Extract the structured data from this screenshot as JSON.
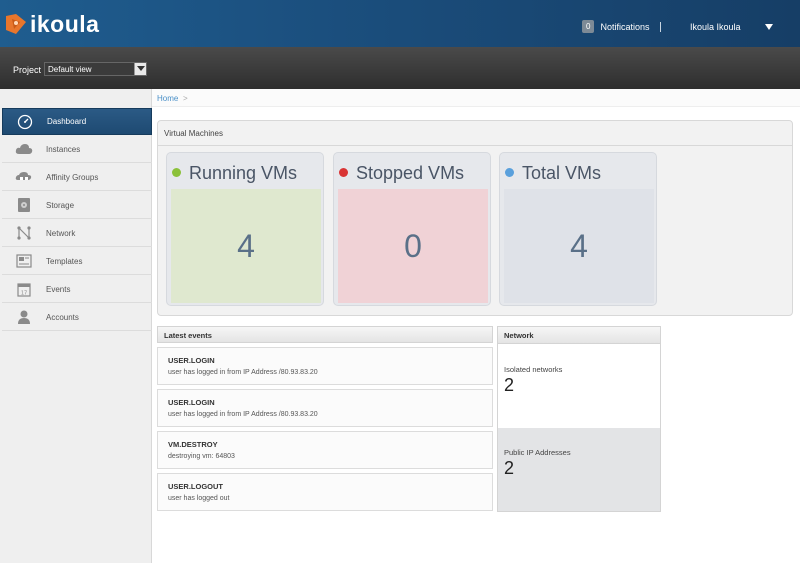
{
  "header": {
    "logo_text": "ikoula",
    "notifications_count": "0",
    "notifications_label": "Notifications",
    "separator": "|",
    "user_name": "Ikoula Ikoula"
  },
  "project": {
    "label": "Project",
    "selected": "Default view"
  },
  "sidebar": {
    "items": [
      {
        "label": "Dashboard",
        "icon": "dashboard-icon",
        "active": true
      },
      {
        "label": "Instances",
        "icon": "cloud-icon"
      },
      {
        "label": "Affinity Groups",
        "icon": "affinity-icon"
      },
      {
        "label": "Storage",
        "icon": "storage-icon"
      },
      {
        "label": "Network",
        "icon": "network-icon"
      },
      {
        "label": "Templates",
        "icon": "templates-icon"
      },
      {
        "label": "Events",
        "icon": "calendar-icon"
      },
      {
        "label": "Accounts",
        "icon": "user-icon"
      }
    ]
  },
  "breadcrumb": {
    "home": "Home",
    "separator": ">"
  },
  "vm_panel": {
    "title": "Virtual Machines",
    "cards": [
      {
        "label": "Running VMs",
        "value": "4",
        "dot_color": "#8bc13a",
        "box_color": "#dfe8cf"
      },
      {
        "label": "Stopped VMs",
        "value": "0",
        "dot_color": "#d93434",
        "box_color": "#f0d2d6"
      },
      {
        "label": "Total VMs",
        "value": "4",
        "dot_color": "#5aa0dc",
        "box_color": "#dfe2e8"
      }
    ]
  },
  "events": {
    "title": "Latest events",
    "items": [
      {
        "title": "USER.LOGIN",
        "desc": "user has logged in from IP Address /80.93.83.20"
      },
      {
        "title": "USER.LOGIN",
        "desc": "user has logged in from IP Address /80.93.83.20"
      },
      {
        "title": "VM.DESTROY",
        "desc": "destroying vm: 64803"
      },
      {
        "title": "USER.LOGOUT",
        "desc": "user has logged out"
      }
    ]
  },
  "network": {
    "title": "Network",
    "blocks": [
      {
        "label": "Isolated networks",
        "value": "2"
      },
      {
        "label": "Public IP Addresses",
        "value": "2"
      }
    ]
  }
}
